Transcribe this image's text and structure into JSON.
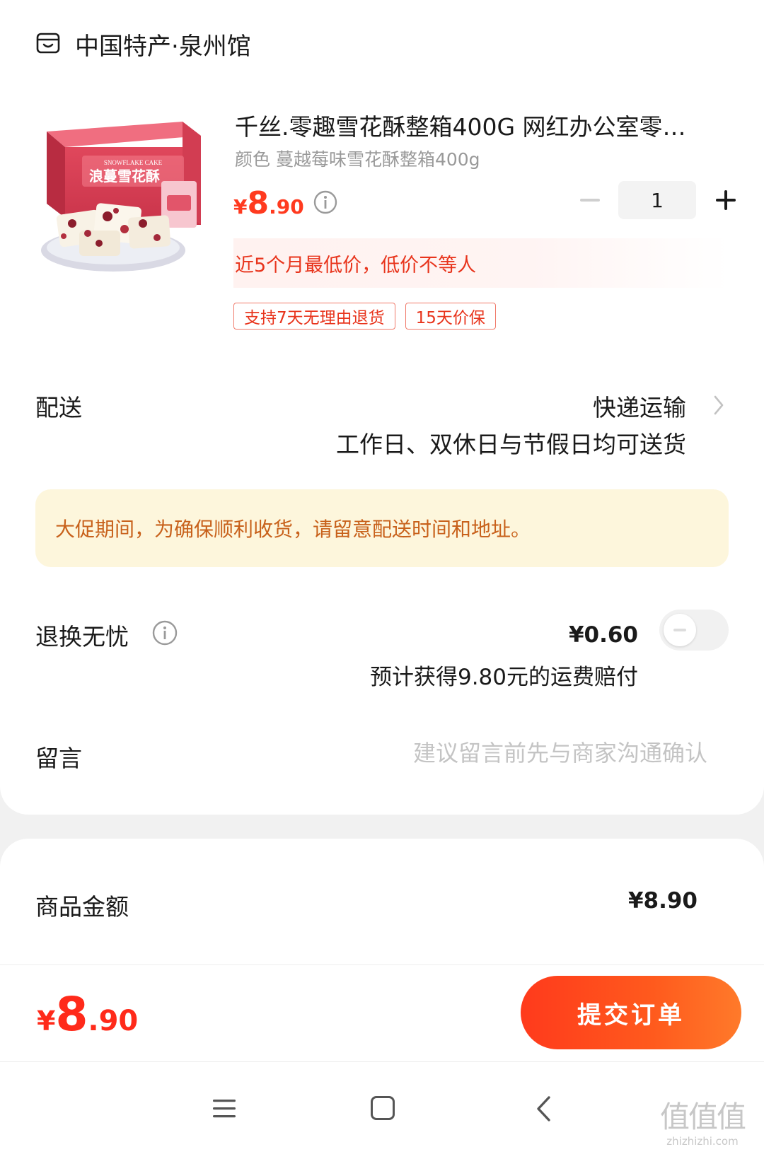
{
  "shop": {
    "name": "中国特产·泉州馆",
    "icon": "store-icon"
  },
  "product": {
    "title": "千丝.零趣雪花酥整箱400G 网红办公室零…",
    "spec": "颜色 蔓越莓味雪花酥整箱400g",
    "price_symbol": "¥",
    "price_int": "8",
    "price_dec": ".90",
    "quantity": "1",
    "lowprice_text": "近5个月最低价，低价不等人",
    "tags": [
      "支持7天无理由退货",
      "15天价保"
    ],
    "image_text": {
      "brand": "SNOWFLAKE CAKE",
      "name": "浪蔓雪花酥"
    }
  },
  "delivery": {
    "label": "配送",
    "method": "快递运输",
    "note": "工作日、双休日与节假日均可送货"
  },
  "notice": "大促期间，为确保顺利收货，请留意配送时间和地址。",
  "return_insurance": {
    "label": "退换无忧",
    "price": "¥0.60",
    "note": "预计获得9.80元的运费赔付",
    "enabled": false
  },
  "message": {
    "label": "留言",
    "placeholder": "建议留言前先与商家沟通确认"
  },
  "summary": {
    "amount_label": "商品金额",
    "amount_value": "¥8.90"
  },
  "footer": {
    "total_symbol": "¥",
    "total_int": "8",
    "total_dec": ".90",
    "submit_label": "提交订单"
  },
  "watermark": {
    "glyphs": "值值值",
    "url": "zhizhizhi.com"
  },
  "colors": {
    "accent": "#ff3a1f",
    "notice_bg": "#fdf6dc",
    "notice_text": "#c8611b"
  }
}
